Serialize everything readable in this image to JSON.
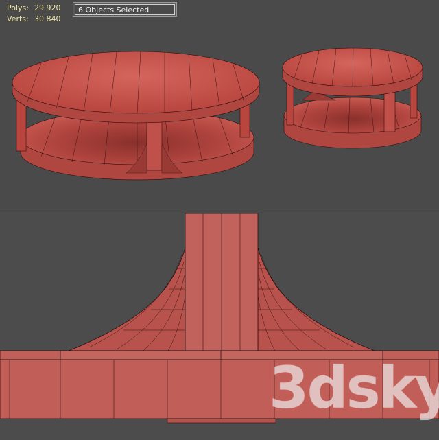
{
  "stats": {
    "polys_label": "Polys:",
    "polys_value": "29 920",
    "verts_label": "Verts:",
    "verts_value": "30 840"
  },
  "selection": {
    "text": "6 Objects Selected"
  },
  "watermark": {
    "text": "3dsky"
  },
  "colors": {
    "viewport_bg": "#4a4a4a",
    "mesh_fill": "#c0504a",
    "mesh_shadow": "#7a2a28",
    "wire": "#2a1010",
    "stats_text": "#f2e8a8"
  }
}
